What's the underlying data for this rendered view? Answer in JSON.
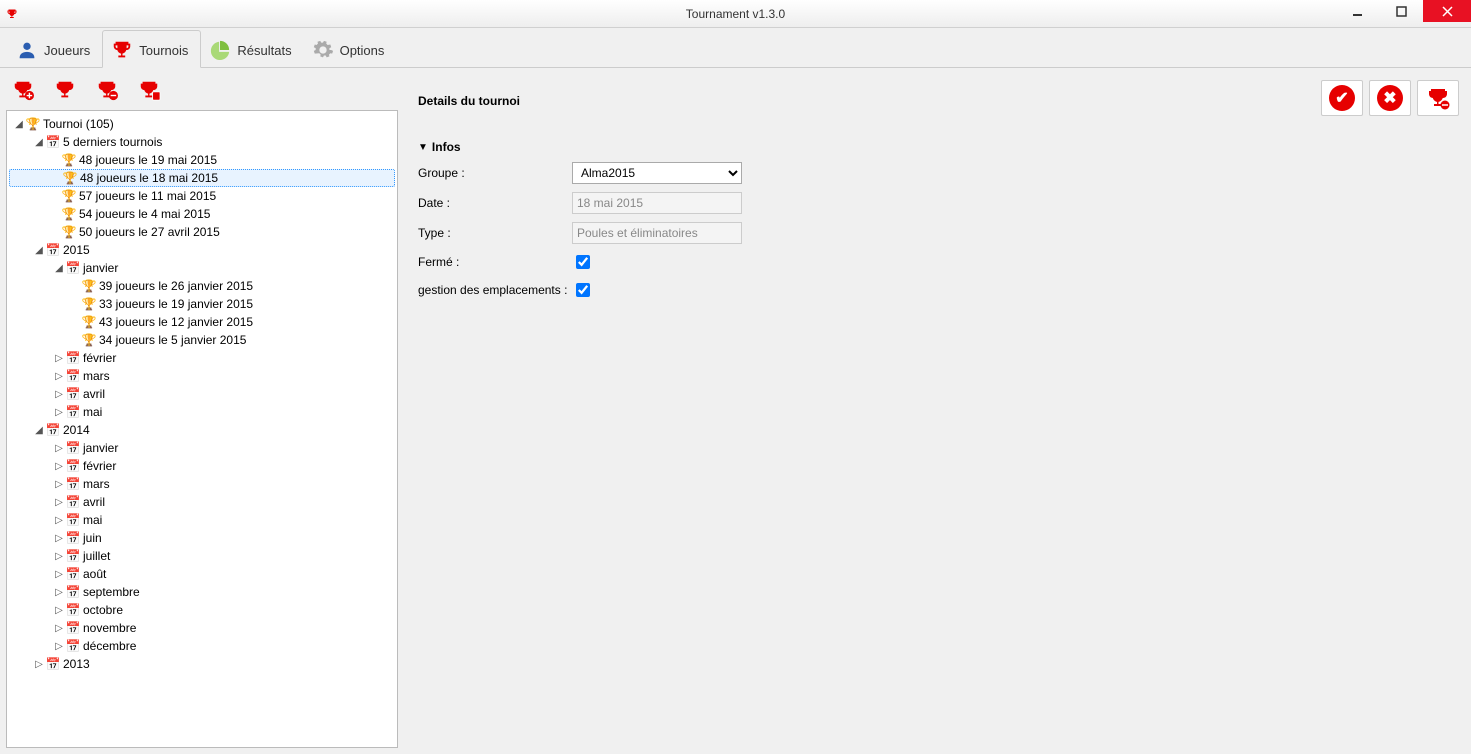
{
  "window": {
    "title": "Tournament v1.3.0"
  },
  "tabs": {
    "joueurs": "Joueurs",
    "tournois": "Tournois",
    "resultats": "Résultats",
    "options": "Options"
  },
  "tree": {
    "root": "Tournoi (105)",
    "recent_label": "5 derniers tournois",
    "recent": [
      "48 joueurs le 19 mai 2015",
      "48 joueurs le 18 mai 2015",
      "57 joueurs le 11 mai 2015",
      "54 joueurs le 4 mai 2015",
      "50 joueurs le 27 avril 2015"
    ],
    "y2015": {
      "label": "2015",
      "janvier": {
        "label": "janvier",
        "items": [
          "39 joueurs le 26 janvier 2015",
          "33 joueurs le 19 janvier 2015",
          "43 joueurs le 12 janvier 2015",
          "34 joueurs le 5 janvier 2015"
        ]
      },
      "months_collapsed": [
        "février",
        "mars",
        "avril",
        "mai"
      ]
    },
    "y2014": {
      "label": "2014",
      "months": [
        "janvier",
        "février",
        "mars",
        "avril",
        "mai",
        "juin",
        "juillet",
        "août",
        "septembre",
        "octobre",
        "novembre",
        "décembre"
      ]
    },
    "y2013": {
      "label": "2013"
    }
  },
  "details": {
    "title": "Details du tournoi",
    "section": "Infos",
    "groupe_label": "Groupe :",
    "groupe_value": "Alma2015",
    "date_label": "Date :",
    "date_value": "18 mai 2015",
    "type_label": "Type :",
    "type_value": "Poules et éliminatoires",
    "ferme_label": "Fermé :",
    "gestion_label": "gestion des emplacements :"
  }
}
